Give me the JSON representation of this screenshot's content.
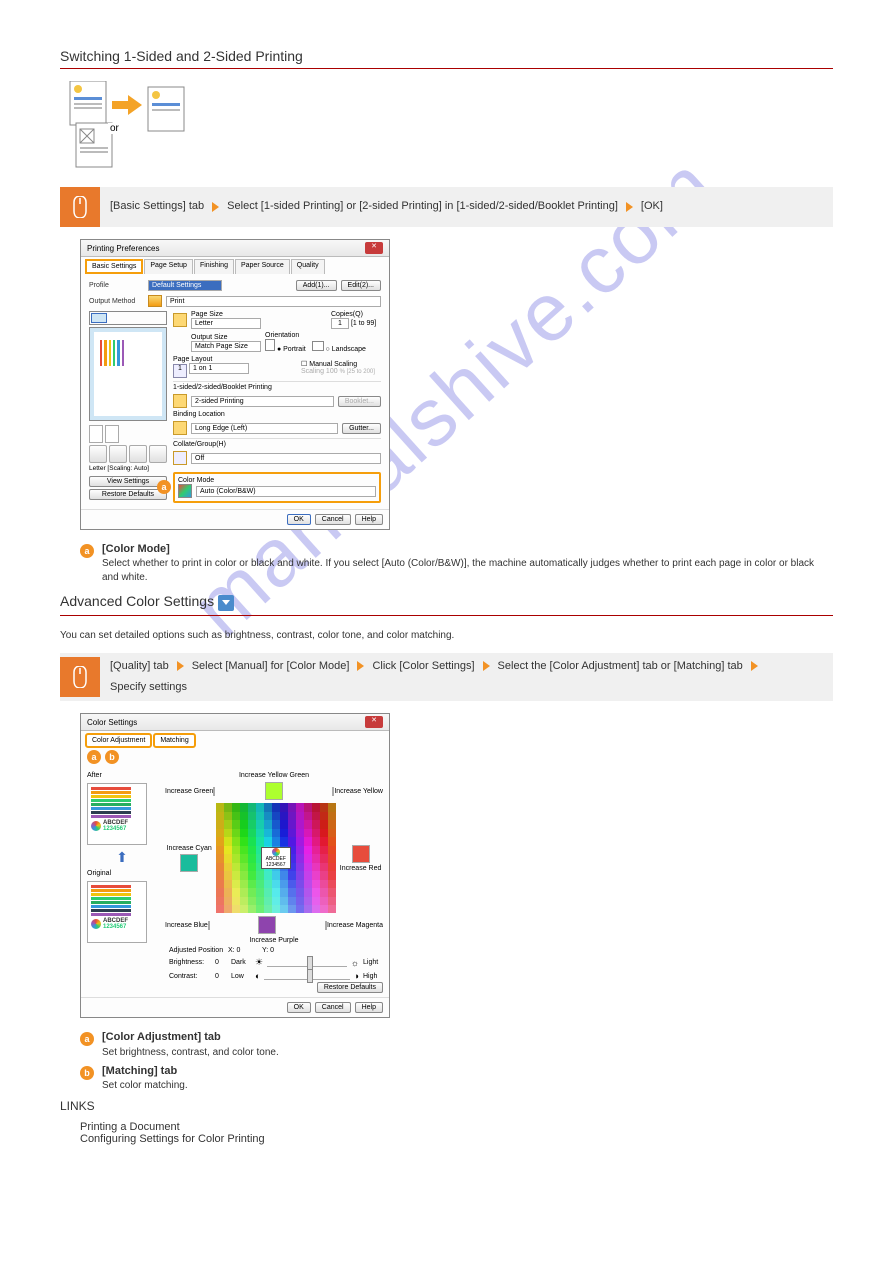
{
  "section1": {
    "title": "Switching 1-Sided and 2-Sided Printing",
    "or_label": "or",
    "bar": {
      "part1": "[Basic Settings] tab",
      "part2": "Select [1-sided Printing] or [2-sided Printing] in [1-sided/2-sided/Booklet Printing]",
      "part3": "[OK]"
    }
  },
  "preferences_dialog": {
    "title": "Printing Preferences",
    "tabs": [
      "Basic Settings",
      "Page Setup",
      "Finishing",
      "Paper Source",
      "Quality"
    ],
    "profile_label": "Profile",
    "profile_value": "Default Settings",
    "add_btn": "Add(1)...",
    "edit_btn": "Edit(2)...",
    "output_method_label": "Output Method",
    "output_method_value": "Print",
    "page_size_label": "Page Size",
    "page_size_value": "Letter",
    "output_size_label": "Output Size",
    "output_size_value": "Match Page Size",
    "copies_label": "Copies(Q)",
    "copies_value": "1",
    "copies_range": "[1 to 99]",
    "orientation_label": "Orientation",
    "portrait": "Portrait",
    "landscape": "Landscape",
    "page_layout_label": "Page Layout",
    "page_layout_value": "1 on 1",
    "manual_scaling": "Manual Scaling",
    "scaling_label": "Scaling",
    "scaling_value": "100",
    "scaling_range": "% [25 to 200]",
    "sided_label": "1-sided/2-sided/Booklet Printing",
    "sided_value": "2-sided Printing",
    "booklet_btn": "Booklet...",
    "binding_label": "Binding Location",
    "binding_value": "Long Edge (Left)",
    "gutter_btn": "Gutter...",
    "collate_label": "Collate/Group(H)",
    "collate_value": "Off",
    "color_mode_label": "Color Mode",
    "color_mode_value": "Auto (Color/B&W)",
    "preview_caption": "Letter [Scaling: Auto]",
    "view_settings_btn": "View Settings",
    "restore_defaults_btn": "Restore Defaults",
    "ok_btn": "OK",
    "cancel_btn": "Cancel",
    "help_btn": "Help"
  },
  "annotations": {
    "a1_label": "[Color Mode]",
    "a1_desc": "Select whether to print in color or black and white. If you select [Auto (Color/B&W)], the machine automatically judges whether to print each page in color or black and white.",
    "a2_label": "[Color Adjustment] tab",
    "a2_desc": "Set brightness, contrast, and color tone.",
    "a3_label": "[Matching] tab",
    "a3_desc": "Set color matching.",
    "links_heading": "LINKS",
    "link1": "Printing a Document",
    "link2": "Configuring Settings for Color Printing"
  },
  "section2": {
    "title_prefix": "Advanced Color Settings",
    "description": "You can set detailed options such as brightness, contrast, color tone, and color matching.",
    "bar": {
      "part1": "[Quality] tab",
      "part2": "Select [Manual] for [Color Mode]",
      "part3": "Click [Color Settings]",
      "part4": "Select the [Color Adjustment] tab or [Matching] tab",
      "part5": "Specify settings"
    }
  },
  "color_settings_dialog": {
    "title": "Color Settings",
    "tabs": [
      "Color Adjustment",
      "Matching"
    ],
    "after_label": "After",
    "original_label": "Original",
    "sample_label": "ABCDEF",
    "sample_num": "1234567",
    "inc_yellow_green": "Increase Yellow Green",
    "inc_green": "Increase Green",
    "inc_yellow": "Increase Yellow",
    "inc_cyan": "Increase Cyan",
    "inc_red": "Increase Red",
    "inc_blue": "Increase Blue",
    "inc_magenta": "Increase Magenta",
    "inc_purple": "Increase Purple",
    "adjusted_position": "Adjusted Position",
    "x_val": "X: 0",
    "y_val": "Y: 0",
    "brightness_label": "Brightness:",
    "brightness_val": "0",
    "dark": "Dark",
    "light": "Light",
    "contrast_label": "Contrast:",
    "contrast_val": "0",
    "low": "Low",
    "high": "High",
    "restore_btn": "Restore Defaults",
    "ok_btn": "OK",
    "cancel_btn": "Cancel",
    "help_btn": "Help"
  }
}
